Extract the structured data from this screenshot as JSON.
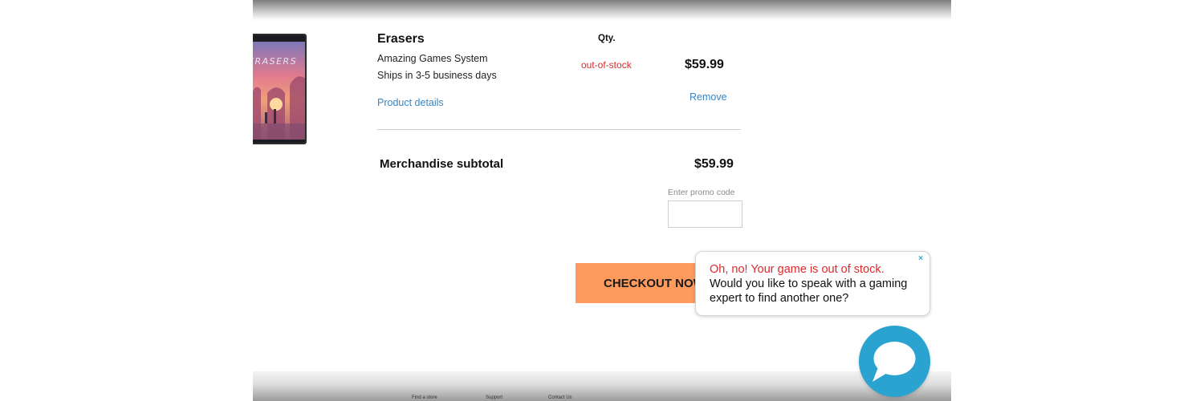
{
  "cart": {
    "item": {
      "name": "Erasers",
      "platform": "Amazing Games System",
      "shipping": "Ships in 3-5 business days",
      "details_link": "Product details",
      "qty_label": "Qty.",
      "stock_status": "out-of-stock",
      "price": "$59.99",
      "remove_link": "Remove",
      "cover_title": "ERASERS"
    },
    "subtotal": {
      "label": "Merchandise subtotal",
      "value": "$59.99"
    },
    "promo": {
      "label": "Enter promo code",
      "value": ""
    },
    "checkout_label": "CHECKOUT NOW"
  },
  "chat": {
    "close": "×",
    "line1": "Oh, no! Your game is out of stock.",
    "line2": "Would you like to speak with a gaming",
    "line3": "expert to find another one?",
    "launcher_icon": "chat-bubble-icon"
  },
  "footer": {
    "links": [
      "Find a store",
      "Support",
      "Contact Us"
    ]
  },
  "colors": {
    "accent_link": "#3a86c2",
    "error": "#e0282b",
    "checkout": "#fe9a5c",
    "chat": "#2aa3d1"
  }
}
